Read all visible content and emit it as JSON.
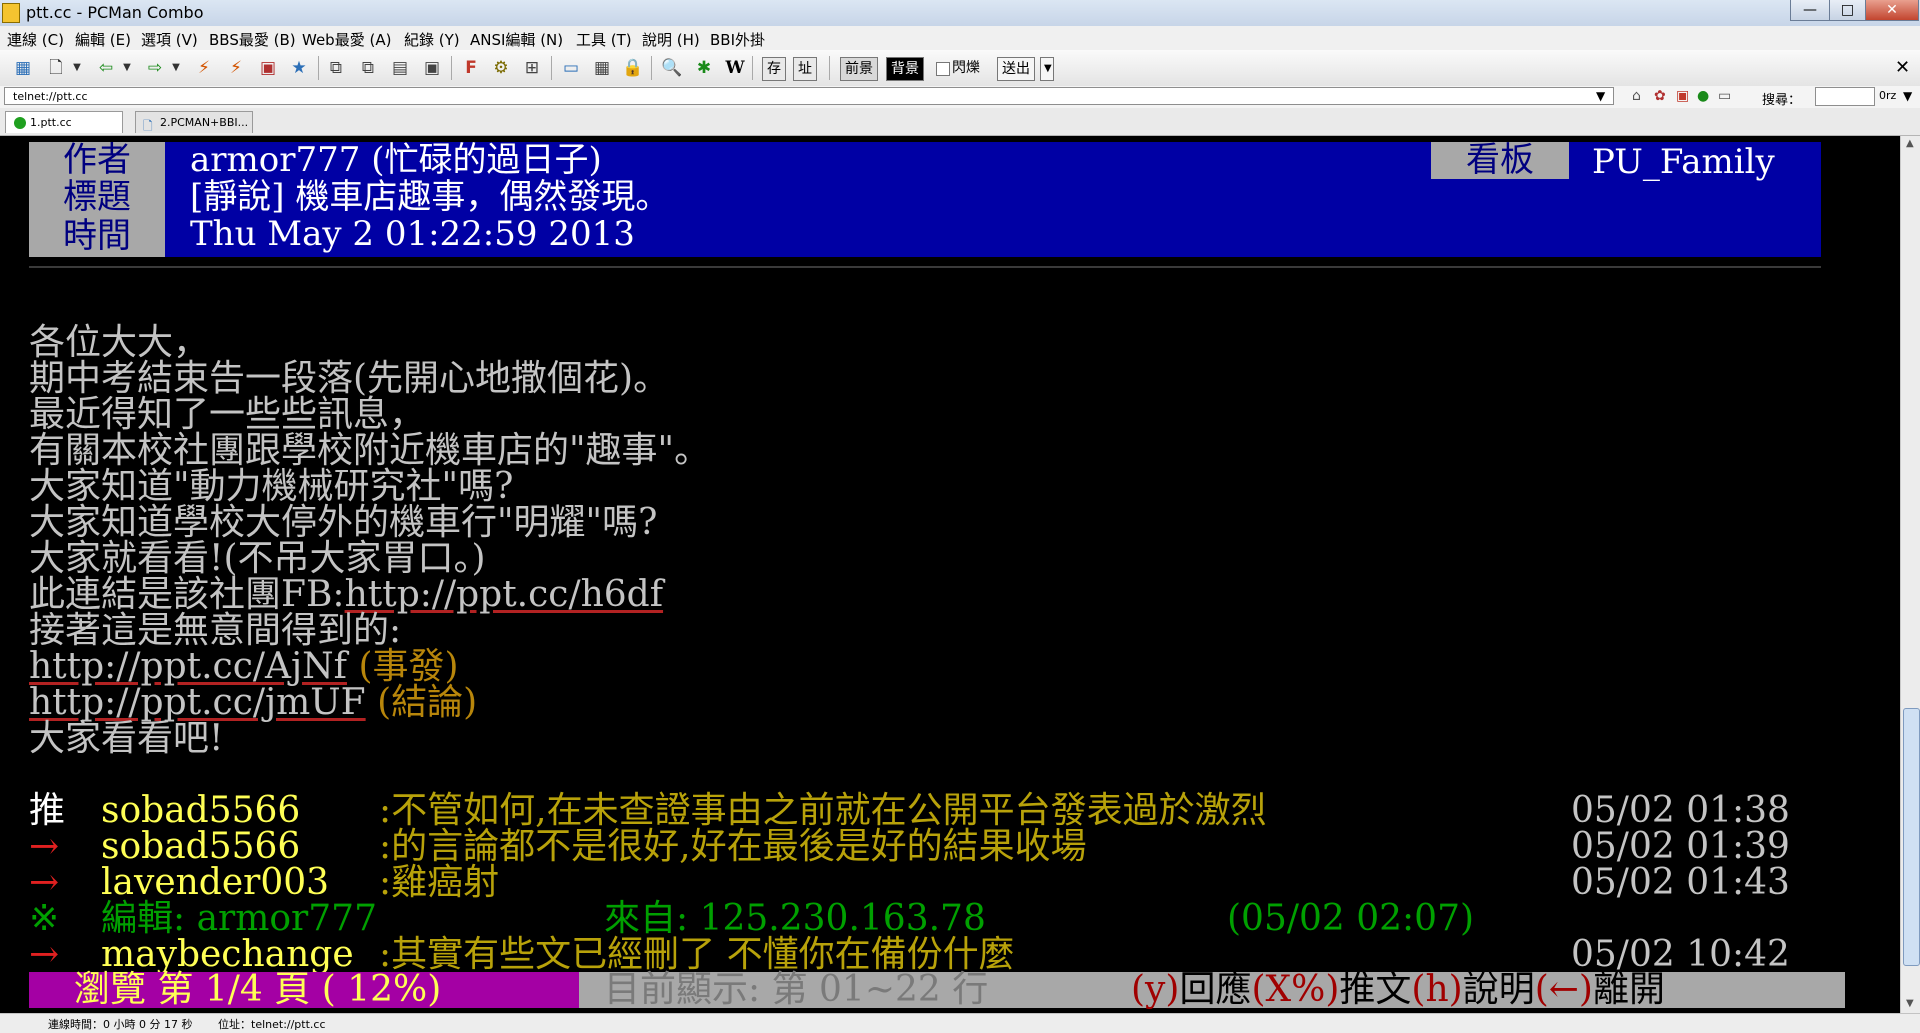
{
  "window": {
    "title": "ptt.cc - PCMan Combo",
    "buttons": {
      "minimize": "—",
      "maximize": "□",
      "close": "✕"
    }
  },
  "menu": [
    "連線 (C)",
    "編輯 (E)",
    "選項 (V)",
    "BBS最愛 (B)",
    "Web最愛 (A)",
    "紀錄 (Y)",
    "ANSI編輯 (N)",
    "工具 (T)",
    "說明 (H)",
    "BBI外掛"
  ],
  "toolbar": {
    "fg_label": "前景",
    "bg_label": "背景",
    "blink_label": "閃爍",
    "send_label": "送出",
    "close_icon": "✕",
    "save_label": "存",
    "addr_label": "址"
  },
  "address": {
    "value": "telnet://ptt.cc"
  },
  "search": {
    "label": "搜尋：",
    "extra": "0rz"
  },
  "tabs": [
    {
      "label": "1.ptt.cc",
      "icon": "green-dot-icon",
      "active": true
    },
    {
      "label": "2.PCMAN+BBI...",
      "icon": "page-icon",
      "active": false
    }
  ],
  "article": {
    "header": {
      "author_label": "作者",
      "author_value": "armor777 (忙碌的過日子)",
      "board_label": "看板",
      "board_value": "PU_Family",
      "title_label": "標題",
      "title_value": "[靜說] 機車店趣事，偶然發現。",
      "time_label": "時間",
      "time_value": "Thu May  2 01:22:59 2013"
    },
    "body": [
      "各位大大，",
      "期中考結束告一段落(先開心地撒個花)。",
      "最近得知了一些些訊息，",
      "有關本校社團跟學校附近機車店的\"趣事\"。",
      "大家知道\"動力機械研究社\"嗎?",
      "大家知道學校大停外的機車行\"明耀\"嗎?",
      "大家就看看!(不吊大家胃口。)"
    ],
    "fb_line": {
      "prefix": "此連結是該社團FB:",
      "url": "http://ppt.cc/h6df"
    },
    "found_line": "接著這是無意間得到的:",
    "link1": {
      "url": "http://ppt.cc/AjNf",
      "note": " (事發)"
    },
    "link2": {
      "url": "http://ppt.cc/jmUF",
      "note": " (結論)"
    },
    "closing": "大家看看吧!",
    "pushes": [
      {
        "tag": "推",
        "user": "sobad5566",
        "msg": ":不管如何,在未查證事由之前就在公開平台發表過於激烈",
        "time": "05/02 01:38"
      },
      {
        "tag": "→",
        "user": "sobad5566",
        "msg": ":的言論都不是很好,好在最後是好的結果收場",
        "time": "05/02 01:39"
      },
      {
        "tag": "→",
        "user": "lavender003",
        "msg": ":雞癌射",
        "time": "05/02 01:43"
      }
    ],
    "edit_line": {
      "mark": "※",
      "text": "編輯: armor777",
      "from": "來自: 125.230.163.78",
      "when": "(05/02 02:07)"
    },
    "last_push": {
      "tag": "→",
      "user": "maybechange",
      "msg": ":其實有些文已經刪了 不懂你在備份什麼",
      "time": "05/02 10:42"
    },
    "footer": {
      "left": "瀏覽 第 1/4 頁 ( 12%)",
      "middle": "目前顯示: 第 01~22 行",
      "k1": "(y)",
      "a1": "回應",
      "k2": "(X%)",
      "a2": "推文",
      "k3": "(h)",
      "a3": "說明",
      "k4": "(←)",
      "a4": "離開"
    }
  },
  "status": {
    "connected": "連線時間：0 小時 0 分 17 秒",
    "address": "位址：telnet://ptt.cc"
  },
  "colors": {
    "term_bg": "#000000",
    "header_bg": "#0000a4",
    "footer_left": "#a400a4",
    "push_user": "#ffff55",
    "push_msg": "#b8a20a",
    "edit_green": "#00a000",
    "link_underline": "#b22222"
  }
}
